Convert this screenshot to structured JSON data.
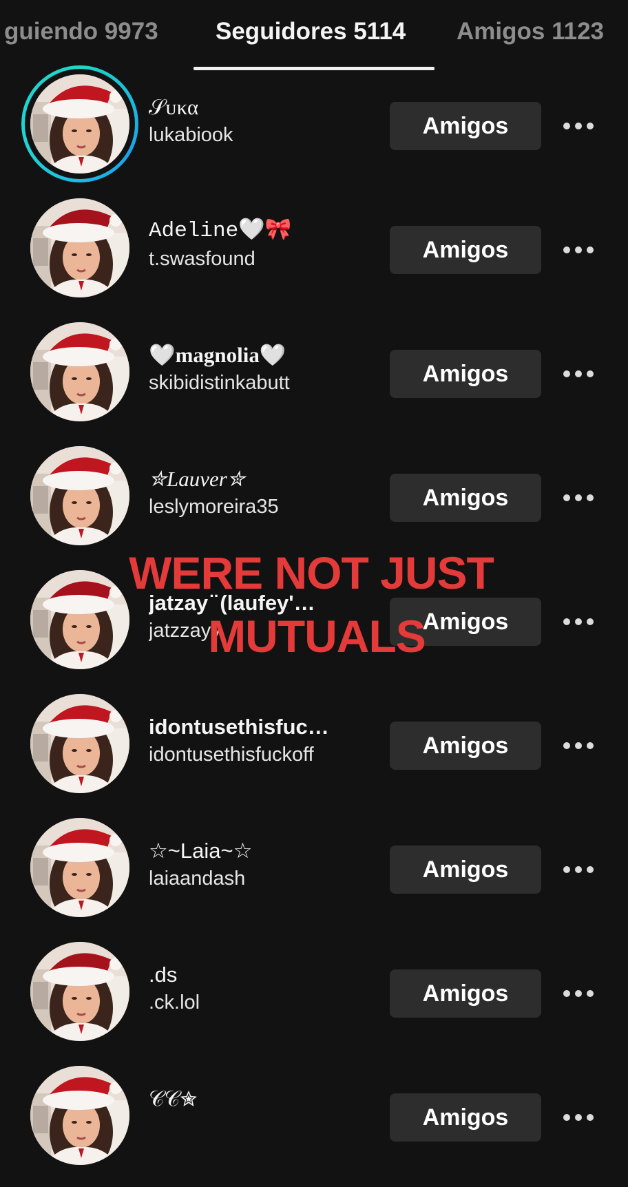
{
  "tabs": [
    {
      "label": "guiendo 9973",
      "active": false
    },
    {
      "label": "Seguidores 5114",
      "active": true
    },
    {
      "label": "Amigos 1123",
      "active": false
    }
  ],
  "button_label": "Amigos",
  "overlay": {
    "line1": "WERE NOT JUST",
    "line2": "MUTUALS",
    "color": "#e53a3a"
  },
  "accent_ring_color": "#1fd6c6",
  "followers": [
    {
      "display_name": "𝒮ᴜκα",
      "username": "lukabiook",
      "has_story": true
    },
    {
      "display_name": "Adeline🤍🎀",
      "username": "t.swasfound",
      "has_story": false
    },
    {
      "display_name": "🤍magnolia🤍",
      "username": "skibidistinkabutt",
      "has_story": false
    },
    {
      "display_name": "✮Lauver✮",
      "username": "leslymoreira35",
      "has_story": false
    },
    {
      "display_name": "jatzay ̈ (laufey'…",
      "username": "jatzzayy",
      "has_story": false
    },
    {
      "display_name": "idontusethisfuc…",
      "username": "idontusethisfuckoff",
      "has_story": false
    },
    {
      "display_name": "☆~Laia~☆",
      "username": "laiaandash",
      "has_story": false
    },
    {
      "display_name": ".ds",
      "username": ".ck.lol",
      "has_story": false
    },
    {
      "display_name": "𝒞𝒞✮",
      "username": "",
      "has_story": false
    }
  ]
}
